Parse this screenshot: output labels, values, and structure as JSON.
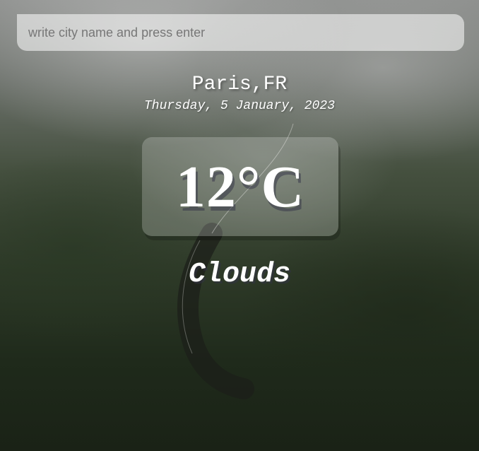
{
  "search": {
    "placeholder": "write city name and press enter",
    "value": ""
  },
  "location": {
    "label": "Paris,FR"
  },
  "date": {
    "label": "Thursday, 5 January, 2023"
  },
  "weather": {
    "temperature": "12°C",
    "condition": "Clouds"
  }
}
